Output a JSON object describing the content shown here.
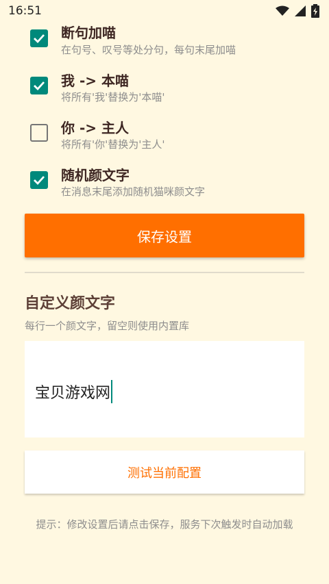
{
  "status_bar": {
    "time": "16:51",
    "icons": [
      "wifi-icon",
      "signal-icon",
      "battery-charging-icon"
    ]
  },
  "options": [
    {
      "title": "断句加喵",
      "subtitle": "在句号、叹号等处分句，每句末尾加喵",
      "checked": true
    },
    {
      "title": "我 -> 本喵",
      "subtitle": "将所有'我'替换为'本喵'",
      "checked": true
    },
    {
      "title": "你 -> 主人",
      "subtitle": "将所有'你'替换为'主人'",
      "checked": false
    },
    {
      "title": "随机颜文字",
      "subtitle": "在消息末尾添加随机猫咪颜文字",
      "checked": true
    }
  ],
  "save_button": {
    "label": "保存设置"
  },
  "custom_section": {
    "title": "自定义颜文字",
    "hint": "每行一个颜文字，留空则使用内置库",
    "input_value": "宝贝游戏网"
  },
  "test_button": {
    "label": "测试当前配置"
  },
  "tip": "提示：修改设置后请点击保存，服务下次触发时自动加载",
  "colors": {
    "background": "#FFF8E1",
    "accent": "#FF6F00",
    "checkbox": "#00897B"
  }
}
